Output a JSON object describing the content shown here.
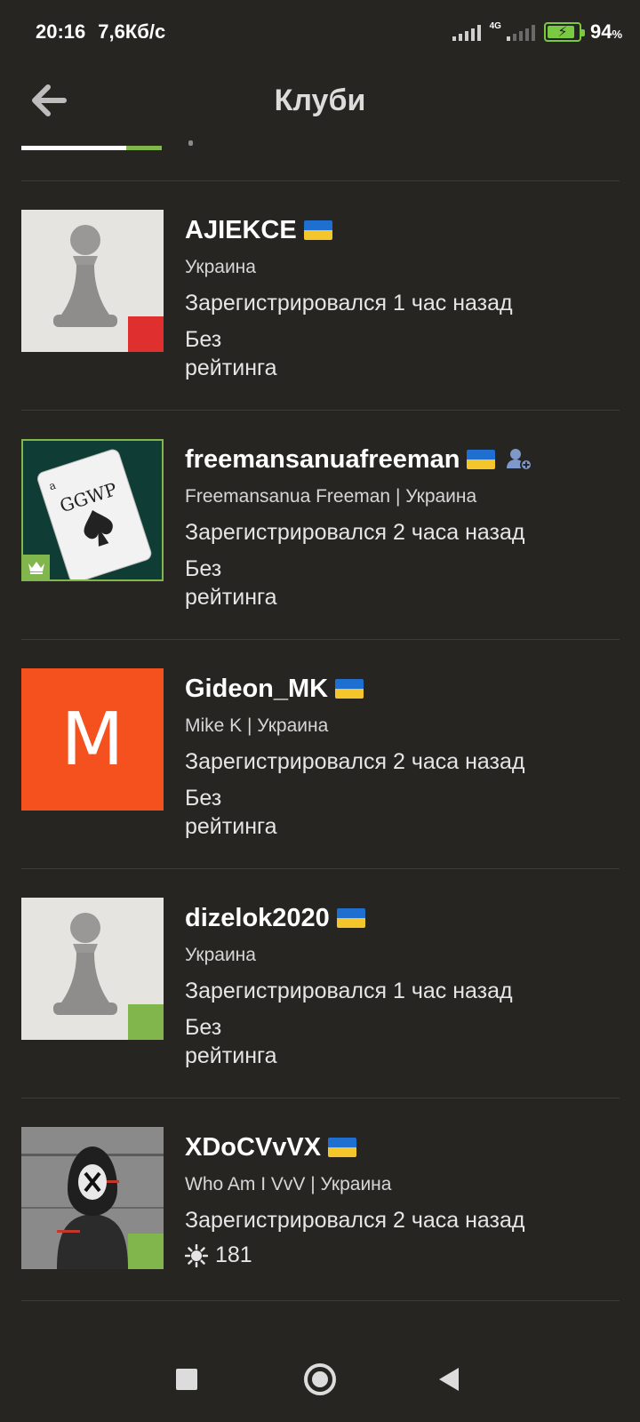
{
  "status_bar": {
    "time": "20:16",
    "speed": "7,6Кб/с",
    "network": "4G",
    "battery_number": "94",
    "battery_unit": "%"
  },
  "header": {
    "title": "Клуби",
    "back_icon": "arrow-left-icon"
  },
  "members": [
    {
      "username": "AJIEKCE",
      "subline": "Украина",
      "joined": "Зарегистрировался 1 час назад",
      "rating": "Без рейтинга",
      "status_color": "#e02f2f"
    },
    {
      "username": "freemansanuafreeman",
      "subline": "Freemansanua Freeman | Украина",
      "joined": "Зарегистрировался 2 часа назад",
      "rating": "Без рейтинга",
      "card_text": "GGWP"
    },
    {
      "username": "Gideon_MK",
      "subline": "Mike K | Украина",
      "joined": "Зарегистрировался 2 часа назад",
      "rating": "Без рейтинга",
      "avatar_letter": "M",
      "avatar_color": "#f4511e"
    },
    {
      "username": "dizelok2020",
      "subline": "Украина",
      "joined": "Зарегистрировался 1 час назад",
      "rating": "Без рейтинга",
      "status_color": "#81b64c"
    },
    {
      "username": "XDoCVvVX",
      "subline": "Who Am I VvV | Украина",
      "joined": "Зарегистрировался 2 часа назад",
      "rating": "181",
      "status_color": "#81b64c"
    }
  ],
  "colors": {
    "background": "#262522",
    "online_green": "#81b64c",
    "offline_red": "#e02f2f",
    "flag_blue": "#1e6fcf",
    "flag_yellow": "#f5c62b"
  }
}
